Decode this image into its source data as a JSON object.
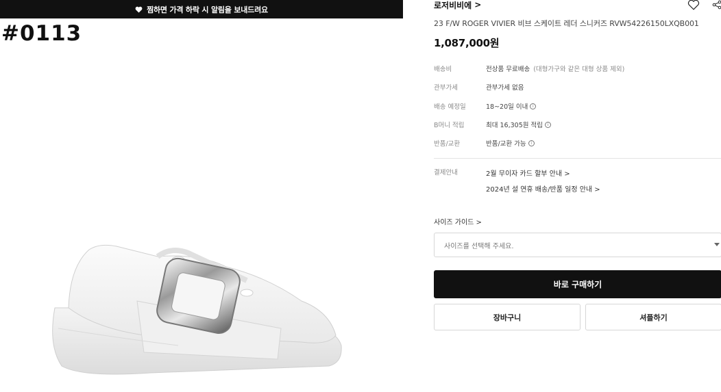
{
  "banner": {
    "icon": "heart-icon",
    "text": "찜하면 가격 하락 시 알림을 보내드려요"
  },
  "code_label": "#0113",
  "product": {
    "brand": "로저비비에",
    "brand_chevron": ">",
    "name": "23 F/W ROGER VIVIER 비브 스케이트 레더 스니커즈 RVW54226150LXQB001",
    "price": "1,087,000원",
    "image": "white-leather-sneaker-with-silver-buckle"
  },
  "info": [
    {
      "label": "배송비",
      "value": "전상품 무료배송",
      "sub": "(대형가구와 같은 대형 상품 제외)",
      "icon": ""
    },
    {
      "label": "관부가세",
      "value": "관부가세 없음",
      "sub": "",
      "icon": ""
    },
    {
      "label": "배송 예정일",
      "value": "18~20일 이내",
      "sub": "",
      "icon": "info-icon"
    },
    {
      "label": "B머니 적립",
      "value": "최대 16,305원 적립",
      "sub": "",
      "icon": "info-icon"
    },
    {
      "label": "반품/교환",
      "value": "반품/교환 가능",
      "sub": "",
      "icon": "info-icon"
    }
  ],
  "payment": {
    "label": "결제안내",
    "links": [
      "2월 무이자 카드 할부 안내 >",
      "2024년 설 연휴 배송/반품 일정 안내 >"
    ]
  },
  "size_guide": "사이즈 가이드 >",
  "size_select": {
    "placeholder": "사이즈를 선택해 주세요."
  },
  "buttons": {
    "buy": "바로 구매하기",
    "cart": "장바구니",
    "sample": "셔플하기"
  },
  "colors": {
    "primary": "#111111",
    "border": "#d6d6d6",
    "muted": "#8a8a8a"
  }
}
